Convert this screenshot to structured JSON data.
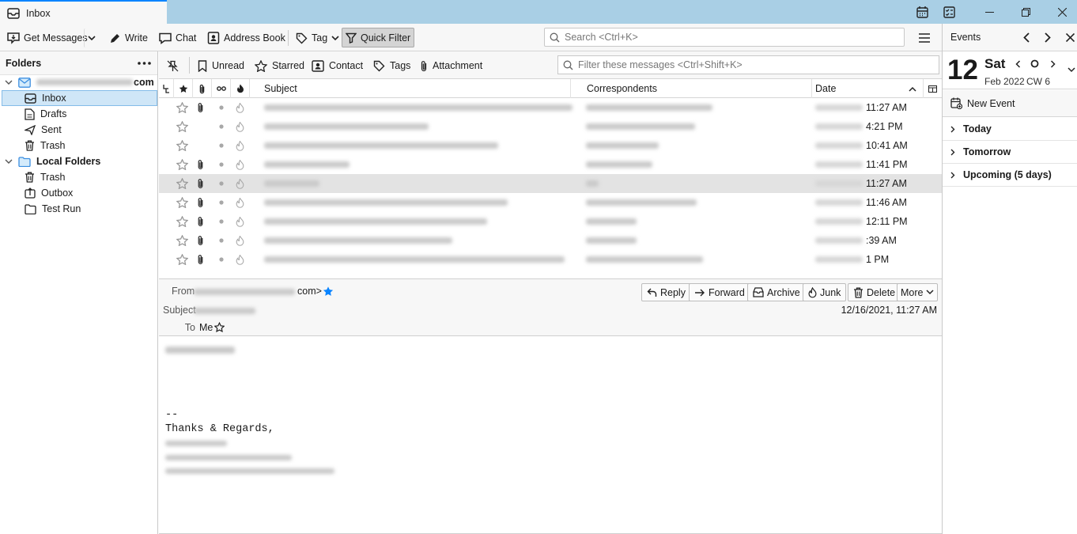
{
  "window": {
    "tab_title": "Inbox"
  },
  "toolbar": {
    "get_messages": "Get Messages",
    "write": "Write",
    "chat": "Chat",
    "address_book": "Address Book",
    "tag": "Tag",
    "quick_filter": "Quick Filter",
    "search_placeholder": "Search <Ctrl+K>"
  },
  "folders": {
    "header": "Folders",
    "account_suffix": "com",
    "items": [
      "Inbox",
      "Drafts",
      "Sent",
      "Trash"
    ],
    "local_folders": "Local Folders",
    "local_items": [
      "Trash",
      "Outbox",
      "Test Run"
    ]
  },
  "quickfilter": {
    "unread": "Unread",
    "starred": "Starred",
    "contact": "Contact",
    "tags": "Tags",
    "attachment": "Attachment",
    "filter_placeholder": "Filter these messages <Ctrl+Shift+K>"
  },
  "columns": {
    "subject": "Subject",
    "correspondents": "Correspondents",
    "date": "Date"
  },
  "messages": [
    {
      "time": "11:27 AM",
      "attachment": true
    },
    {
      "time": "4:21 PM",
      "attachment": false
    },
    {
      "time": "10:41 AM",
      "attachment": false
    },
    {
      "time": "11:41 PM",
      "attachment": true
    },
    {
      "time": "11:27 AM",
      "attachment": true,
      "selected": true
    },
    {
      "time": "11:46 AM",
      "attachment": true
    },
    {
      "time": "12:11 PM",
      "attachment": true
    },
    {
      "time": ":39 AM",
      "attachment": true
    },
    {
      "time": "1 PM",
      "attachment": true
    }
  ],
  "message": {
    "from_label": "From",
    "from_suffix": "com>",
    "subject_label": "Subject",
    "to_label": "To",
    "to_value": "Me",
    "date": "12/16/2021, 11:27 AM",
    "reply": "Reply",
    "forward": "Forward",
    "archive": "Archive",
    "junk": "Junk",
    "delete": "Delete",
    "more": "More",
    "body_sig_sep": "--",
    "body_regards": "Thanks & Regards,"
  },
  "events": {
    "title": "Events",
    "day_number": "12",
    "weekday": "Sat",
    "month_year": "Feb 2022",
    "week": "CW 6",
    "new_event": "New Event",
    "today": "Today",
    "tomorrow": "Tomorrow",
    "upcoming": "Upcoming (5 days)"
  },
  "colors": {
    "accent": "#0a84ff",
    "titlebar": "#a9cfe5",
    "selection": "#cfe6f7"
  }
}
